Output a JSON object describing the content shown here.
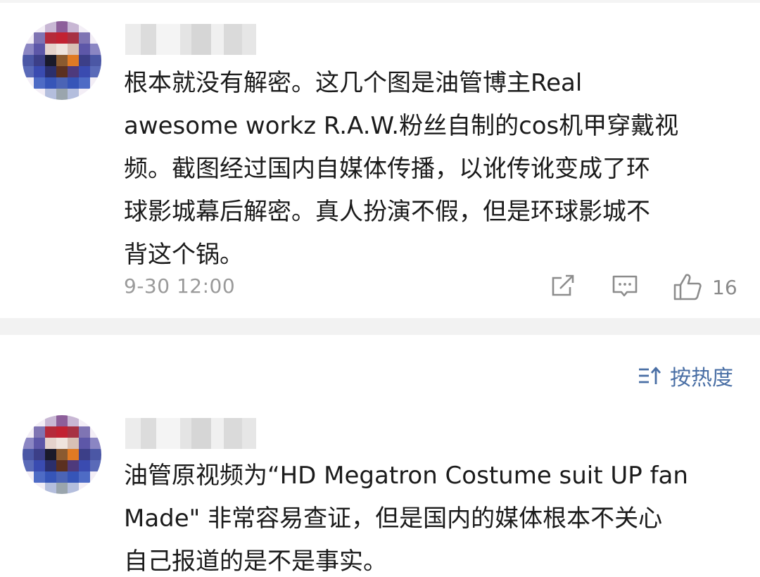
{
  "comments": [
    {
      "text": "根本就没有解密。这几个图是油管博主Real\nawesome workz R.A.W.粉丝自制的cos机甲穿戴视\n频。截图经过国内自媒体传播，以讹传讹变成了环\n球影城幕后解密。真人扮演不假，但是环球影城不\n背这个锅。",
      "timestamp": "9-30 12:00",
      "likes": "16"
    },
    {
      "text": "油管原视频为“HD Megatron Costume suit UP fan\nMade\" 非常容易查证，但是国内的媒体根本不关心\n自己报道的是不是事实。"
    }
  ],
  "sort": {
    "label": "按热度",
    "accent_color": "#4a6fa5"
  },
  "icons": {
    "share": "share-icon",
    "reply": "comment-icon",
    "like": "thumbs-up-icon",
    "sort": "sort-icon"
  }
}
